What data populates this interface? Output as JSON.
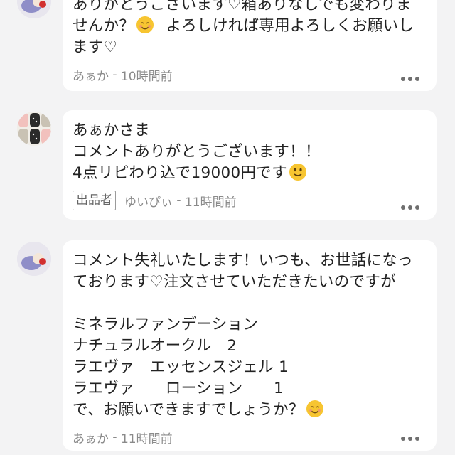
{
  "comments": [
    {
      "line1": "ありがとうございます♡箱ありなしでも変わりま",
      "line2": "せんか？",
      "line2b": "  よろしければ専用よろしくお願いし",
      "line3": "ます♡",
      "author": "あぁか",
      "time": "10時間前"
    },
    {
      "line1": "あぁかさま",
      "line2": "コメントありがとうございます！！",
      "line3": "4点リピわり込で19000円です",
      "seller_badge": "出品者",
      "author": "ゆいぴぃ",
      "time": "11時間前"
    },
    {
      "line1": "コメント失礼いたします！いつも、お世話になっ",
      "line2": "ております♡注文させていただきたいのですが",
      "line3": "",
      "line4": "ミネラルファンデーション",
      "line5": "ナチュラルオークル　2",
      "line6": "ラエヴァ　エッセンスジェル 1",
      "line7": "ラエヴァ　　ローション　　1",
      "line8": "で、お願いできますでしょうか？",
      "author": "あぁか",
      "time": "11時間前"
    }
  ],
  "separator": " - ",
  "icons": {
    "more": "more-dots-icon",
    "smile_blush": "smiling-face-icon",
    "slight_smile": "slightly-smiling-face-icon"
  }
}
